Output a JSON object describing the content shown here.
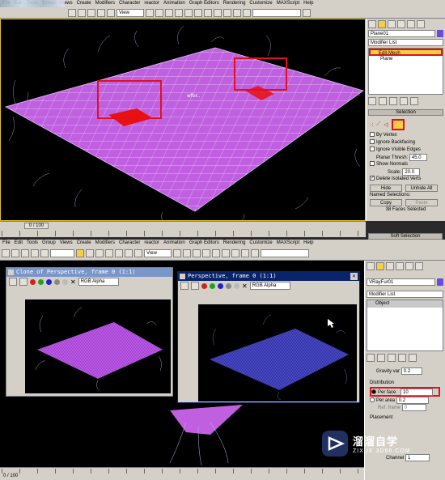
{
  "menus": [
    "File",
    "Edit",
    "Tools",
    "Group",
    "Views",
    "Create",
    "Modifiers",
    "Character",
    "reactor",
    "Animation",
    "Graph Editors",
    "Rendering",
    "Customize",
    "MAXScript",
    "Help"
  ],
  "top": {
    "viewport_dropdown": "View",
    "object_name": "Plane01",
    "modifier_list": "Modifier List",
    "stack_selected": "Edit Mesh",
    "stack_base": "Plane",
    "selection_rollout": "Selection",
    "by_vertex": "By Vertex",
    "ignore_backfacing": "Ignore Backfacing",
    "ignore_visible_edges": "Ignore Visible Edges",
    "planar_thresh_label": "Planar Thresh:",
    "planar_thresh_value": "45.0",
    "show_normals": "Show Normals",
    "scale_label": "Scale:",
    "scale_value": "20.0",
    "delete_isolated": "Delete Isolated Verts",
    "hide": "Hide",
    "unhide_all": "Unhide All",
    "named_selections": "Named Selections:",
    "copy": "Copy",
    "paste": "Paste",
    "faces_selected": "38 Faces Selected",
    "soft_selection": "Soft Selection",
    "time_counter": "0 / 100"
  },
  "bottom": {
    "viewport_dropdown": "View",
    "object_name": "VRayFur01",
    "modifier_list": "Modifier List",
    "stack_item": "Object",
    "gravity_label": "Gravity var",
    "gravity_value": "0.2",
    "distribution": "Distribution",
    "per_face_label": "Per face",
    "per_face_value": "10",
    "per_area_label": "Per area",
    "per_area_value": "0.2",
    "ref_frame_label": "Ref. frame",
    "ref_frame_value": "0",
    "placement": "Placement",
    "channel_label": "Channel",
    "channel_value": "1",
    "time_counter": "0 / 100"
  },
  "vfb_left": {
    "title": "Clone of Perspective, frame 0 (1:1)",
    "channel": "RGB Alpha"
  },
  "vfb_right": {
    "title": "Perspective, frame 0 (1:1)",
    "channel": "RGB Alpha"
  },
  "watermark": {
    "brand": "溜溜自学",
    "url": "ZIXUE.3D66.COM"
  },
  "colors": {
    "mesh": "#c060e0",
    "fur": "#4040c0",
    "highlight": "#e01020",
    "ui": "#d4d0c8",
    "titlebar": "#0a246a"
  }
}
